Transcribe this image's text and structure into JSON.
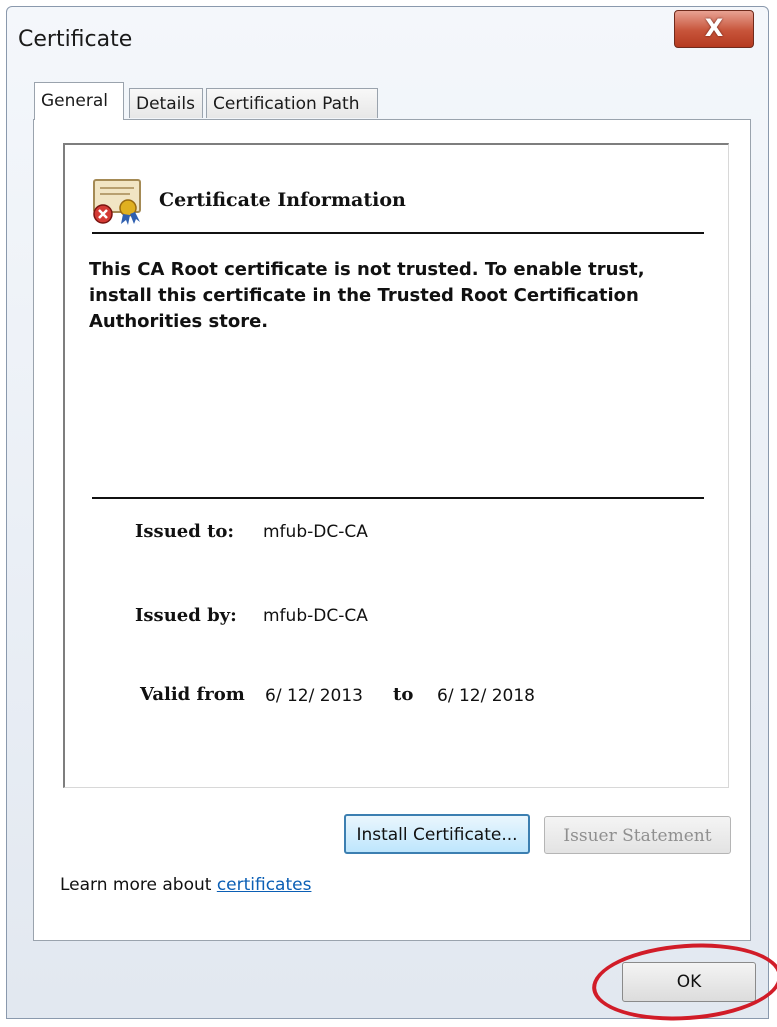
{
  "window": {
    "title": "Certificate",
    "close_glyph": "X"
  },
  "tabs": [
    {
      "label": "General",
      "active": true
    },
    {
      "label": "Details",
      "active": false
    },
    {
      "label": "Certification Path",
      "active": false
    }
  ],
  "info": {
    "icon": "certificate-error-icon",
    "heading": "Certificate Information",
    "message": "This CA Root certificate is not trusted. To enable trust, install this certificate in the Trusted Root Certification Authorities store."
  },
  "fields": {
    "issued_to_label": "Issued to:",
    "issued_to_value": "mfub-DC-CA",
    "issued_by_label": "Issued by:",
    "issued_by_value": "mfub-DC-CA",
    "valid_from_label": "Valid from",
    "valid_from_value": "6/ 12/ 2013",
    "valid_to_label": "to",
    "valid_to_value": "6/ 12/ 2018"
  },
  "buttons": {
    "install": "Install Certificate...",
    "issuer": "Issuer Statement",
    "ok": "OK"
  },
  "learn_more": {
    "prefix": "Learn more about ",
    "link": "certificates"
  },
  "colors": {
    "close_red": "#c7543a",
    "link_blue": "#0b5fb5",
    "highlight_red": "#d11c28"
  }
}
